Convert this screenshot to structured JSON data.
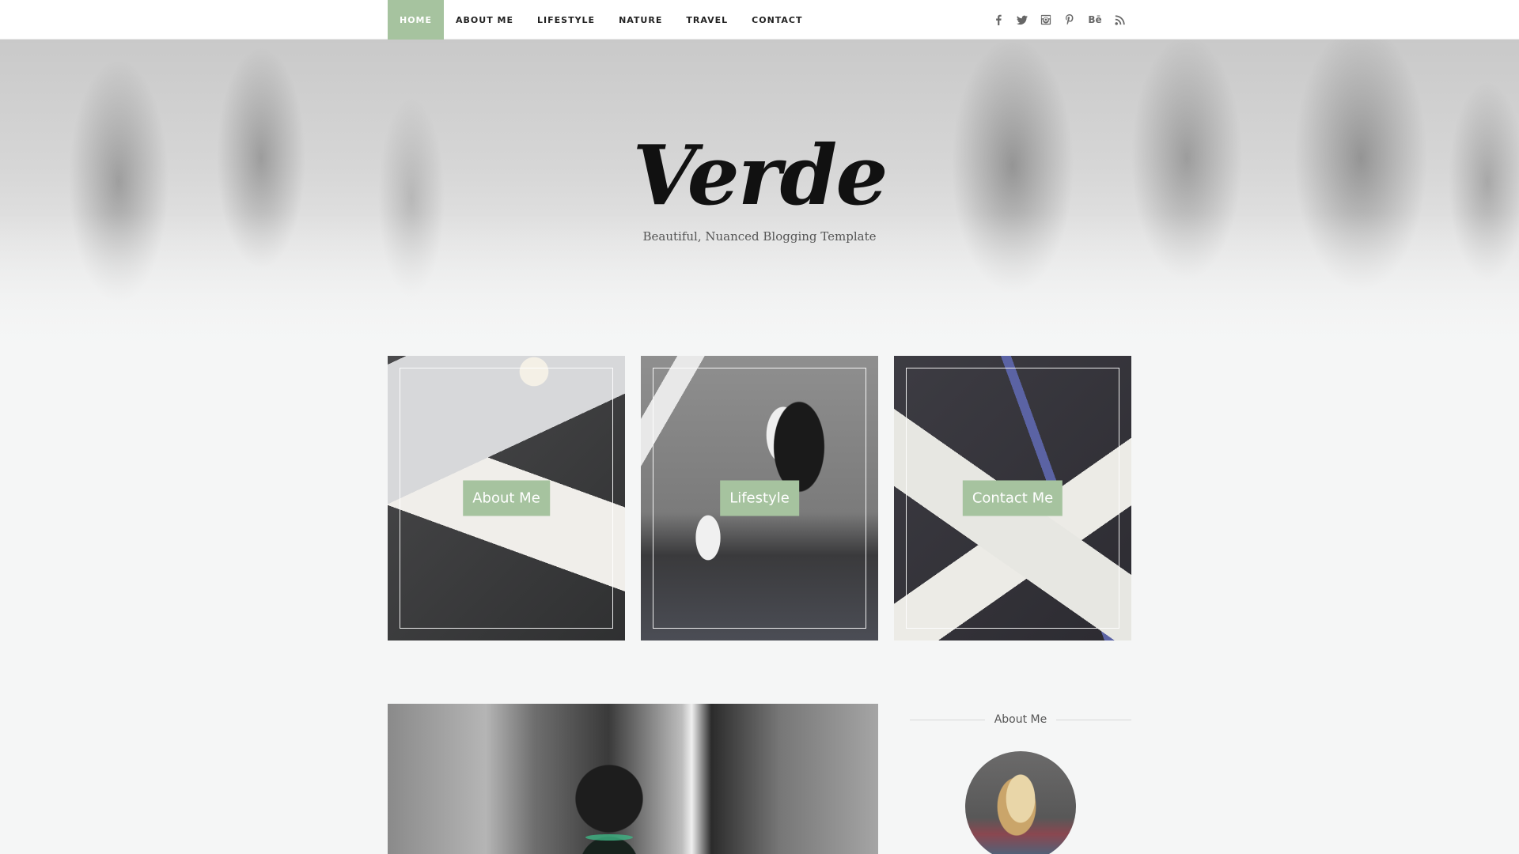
{
  "nav": {
    "items": [
      {
        "label": "HOME",
        "active": true
      },
      {
        "label": "ABOUT ME"
      },
      {
        "label": "LIFESTYLE"
      },
      {
        "label": "NATURE"
      },
      {
        "label": "TRAVEL"
      },
      {
        "label": "CONTACT"
      }
    ],
    "social": [
      "facebook-icon",
      "twitter-icon",
      "instagram-icon",
      "pinterest-icon",
      "behance-icon",
      "rss-icon"
    ],
    "behance_text": "Bē"
  },
  "hero": {
    "logo": "Verde",
    "tagline": "Beautiful, Nuanced Blogging Template"
  },
  "features": [
    {
      "label": "About Me"
    },
    {
      "label": "Lifestyle"
    },
    {
      "label": "Contact Me"
    }
  ],
  "sidebar": {
    "widget_title": "About Me"
  },
  "colors": {
    "accent": "#a6c39f",
    "background": "#f5f6f6"
  }
}
